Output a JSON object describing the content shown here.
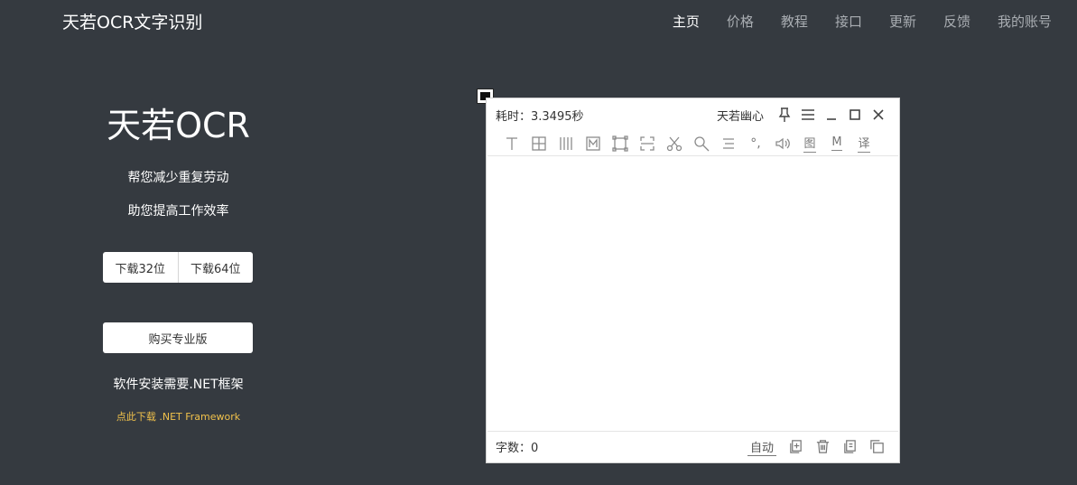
{
  "header": {
    "brand": "天若OCR文字识别",
    "nav": [
      "主页",
      "价格",
      "教程",
      "接口",
      "更新",
      "反馈",
      "我的账号"
    ]
  },
  "hero": {
    "title": "天若OCR",
    "tagline1": "帮您减少重复劳动",
    "tagline2": "助您提高工作效率",
    "download32": "下载32位",
    "download64": "下载64位",
    "buy": "购买专业版",
    "net_note": "软件安装需要.NET框架",
    "net_link": "点此下载 .NET Framework"
  },
  "app": {
    "elapsed": "耗时：3.3495秒",
    "user": "天若幽心",
    "toolbar_text": {
      "char1": "°,",
      "image": "图",
      "m": "M",
      "translate": "译"
    },
    "word_count": "字数：0",
    "auto": "自动"
  },
  "colors": {
    "background": "#353a40",
    "link": "#f0c14b"
  }
}
